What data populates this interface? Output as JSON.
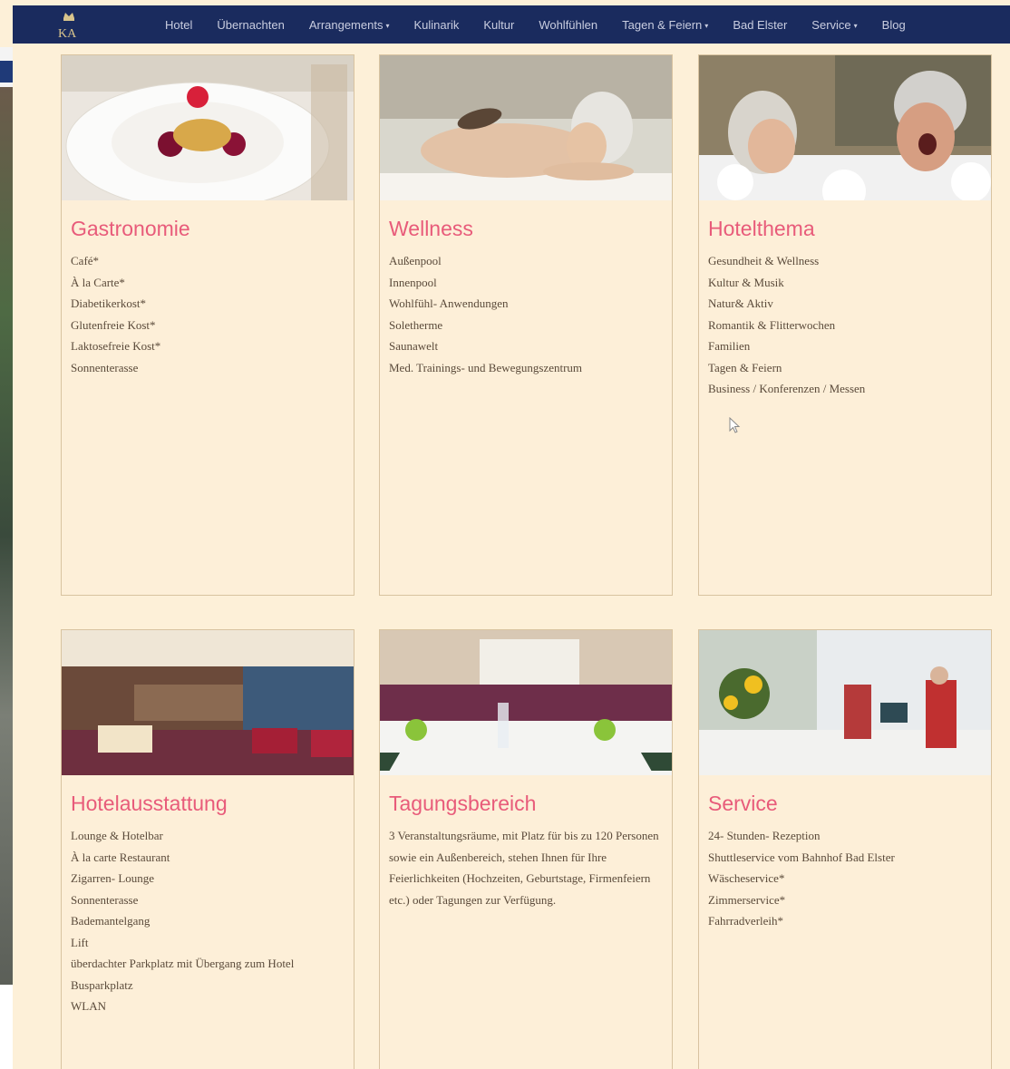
{
  "nav": {
    "items": [
      {
        "label": "Hotel",
        "dropdown": false
      },
      {
        "label": "Übernachten",
        "dropdown": false
      },
      {
        "label": "Arrangements",
        "dropdown": true
      },
      {
        "label": "Kulinarik",
        "dropdown": false
      },
      {
        "label": "Kultur",
        "dropdown": false
      },
      {
        "label": "Wohlfühlen",
        "dropdown": false
      },
      {
        "label": "Tagen & Feiern",
        "dropdown": true
      },
      {
        "label": "Bad Elster",
        "dropdown": false
      },
      {
        "label": "Service",
        "dropdown": true
      },
      {
        "label": "Blog",
        "dropdown": false
      }
    ],
    "caret": "▾"
  },
  "cards": {
    "gastronomie": {
      "title": "Gastronomie",
      "items": [
        "Café*",
        "À la Carte*",
        "Diabetikerkost*",
        "Glutenfreie Kost*",
        "Laktosefreie Kost*",
        "Sonnenterasse"
      ]
    },
    "wellness": {
      "title": "Wellness",
      "items": [
        "Außenpool",
        "Innenpool",
        "Wohlfühl- Anwendungen",
        "Soletherme",
        "Saunawelt",
        "Med. Trainings- und Bewegungszentrum"
      ]
    },
    "hotelthema": {
      "title": "Hotelthema",
      "items": [
        "Gesundheit & Wellness",
        "Kultur & Musik",
        "Natur& Aktiv",
        "Romantik & Flitterwochen",
        "Familien",
        "Tagen & Feiern",
        "Business / Konferenzen / Messen"
      ]
    },
    "hotelausstattung": {
      "title": "Hotelausstattung",
      "items": [
        "Lounge & Hotelbar",
        "À la carte Restaurant",
        "Zigarren- Lounge",
        "Sonnenterasse",
        "Bademantelgang",
        "Lift",
        "überdachter Parkplatz mit Übergang zum Hotel",
        "Busparkplatz",
        "WLAN"
      ]
    },
    "tagungsbereich": {
      "title": "Tagungsbereich",
      "text": "3 Veranstaltungsräume, mit Platz für bis zu 120 Personen sowie ein Außenbereich, stehen Ihnen für Ihre Feierlichkeiten (Hochzeiten, Geburtstage, Firmenfeiern etc.) oder Tagungen zur Verfügung."
    },
    "service": {
      "title": "Service",
      "items": [
        "24- Stunden- Rezeption",
        "Shuttleservice vom Bahnhof Bad Elster",
        "Wäscheservice*",
        "Zimmerservice*",
        "Fahrradverleih*"
      ]
    }
  },
  "colors": {
    "nav_bg": "#1a2b5e",
    "page_bg": "#fdf0d8",
    "title_pink": "#e85b7a",
    "text": "#5a4a3a"
  }
}
